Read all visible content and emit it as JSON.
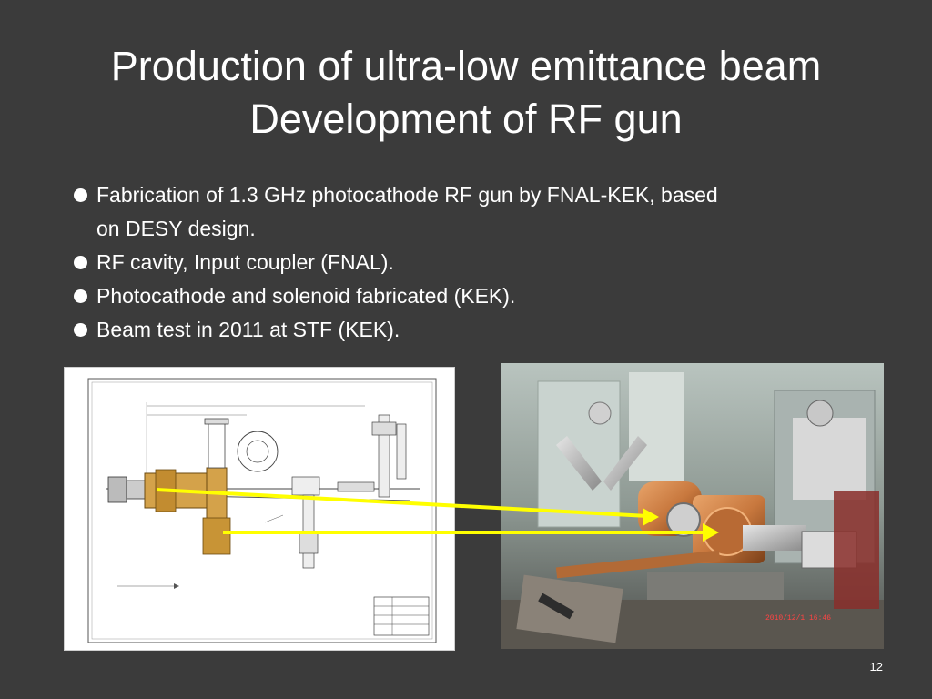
{
  "slide": {
    "title_line1": "Production of ultra-low emittance beam",
    "title_line2": "Development of RF gun",
    "bullets": [
      {
        "line1": "Fabrication of 1.3 GHz photocathode RF gun by FNAL-KEK, based",
        "line2": "on DESY design."
      },
      {
        "line1": "RF cavity, Input coupler (FNAL)."
      },
      {
        "line1": "Photocathode and solenoid fabricated (KEK)."
      },
      {
        "line1": "Beam test in 2011 at STF (KEK)."
      }
    ],
    "page_number": "12"
  },
  "colors": {
    "background": "#3b3b3b",
    "text": "#ffffff",
    "arrow": "#ffff00",
    "copper": "#c8783e",
    "drawing_highlight": "#d4a24a"
  },
  "images": {
    "left": "engineering-drawing",
    "right": "rf-gun-photo"
  },
  "photo_timestamp": "2010/12/1 16:46"
}
